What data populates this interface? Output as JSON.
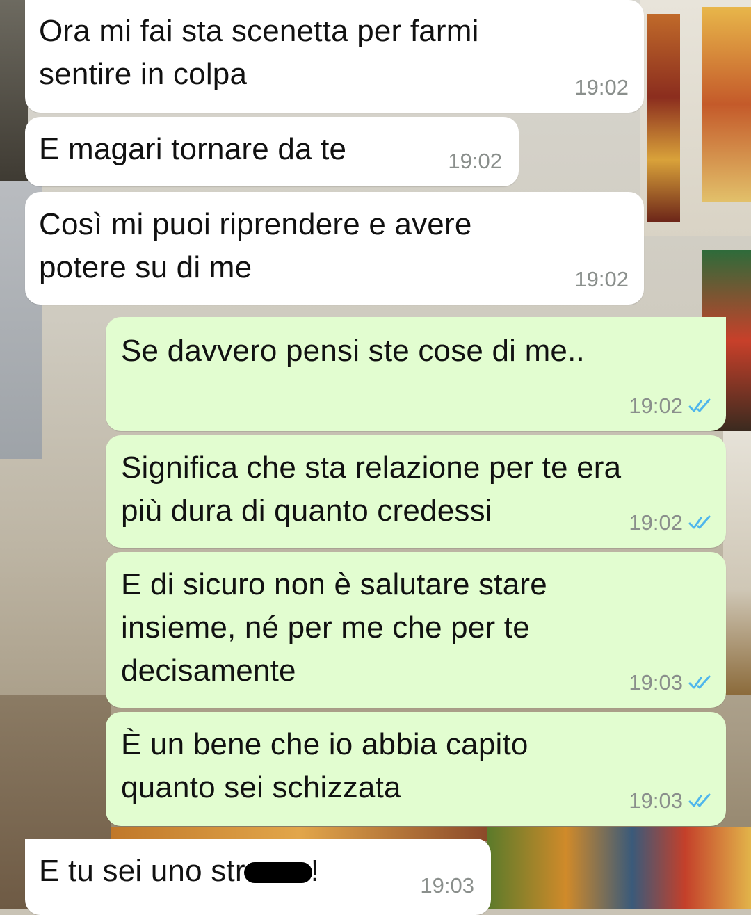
{
  "chat": {
    "messages": [
      {
        "direction": "in",
        "text": "Ora mi fai sta scenetta per farmi\nsentire in colpa",
        "time": "19:02"
      },
      {
        "direction": "in",
        "text": "E magari tornare da te",
        "time": "19:02"
      },
      {
        "direction": "in",
        "text": "Così mi puoi riprendere e avere\npotere su di me",
        "time": "19:02"
      },
      {
        "direction": "out",
        "text": "Se davvero pensi ste cose di me..",
        "time": "19:02",
        "status": "read"
      },
      {
        "direction": "out",
        "text": "Significa che sta relazione per te era\npiù dura di quanto credessi",
        "time": "19:02",
        "status": "read"
      },
      {
        "direction": "out",
        "text": "E di sicuro non è salutare stare\ninsieme, né per me che per te\ndecisamente",
        "time": "19:03",
        "status": "read"
      },
      {
        "direction": "out",
        "text": "È un bene che io abbia capito\nquanto sei schizzata",
        "time": "19:03",
        "status": "read"
      },
      {
        "direction": "in",
        "text_before": "E tu sei uno str",
        "text_after": "!",
        "redacted": true,
        "time": "19:03"
      }
    ]
  },
  "colors": {
    "incoming_bubble": "#ffffff",
    "outgoing_bubble": "#e2fdd0",
    "read_ticks": "#4fb6ec",
    "timestamp": "#8a8f8c"
  }
}
